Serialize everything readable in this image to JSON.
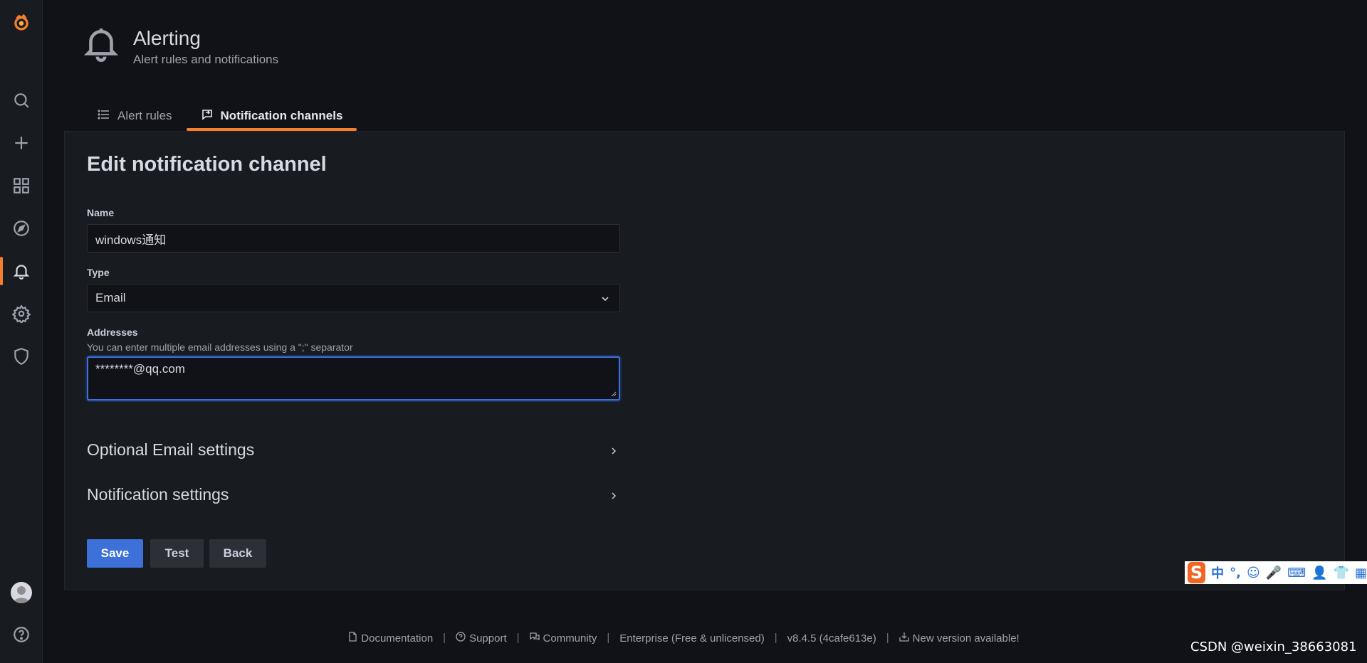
{
  "page": {
    "title": "Alerting",
    "subtitle": "Alert rules and notifications"
  },
  "tabs": [
    {
      "label": "Alert rules",
      "icon": "list-icon"
    },
    {
      "label": "Notification channels",
      "icon": "comment-alt-share-icon"
    }
  ],
  "form": {
    "heading": "Edit notification channel",
    "name_label": "Name",
    "name_value": "windows通知",
    "type_label": "Type",
    "type_value": "Email",
    "addresses_label": "Addresses",
    "addresses_desc": "You can enter multiple email addresses using a \";\" separator",
    "addresses_value": "********@qq.com",
    "optional_email_settings": "Optional Email settings",
    "notification_settings": "Notification settings",
    "save_label": "Save",
    "test_label": "Test",
    "back_label": "Back"
  },
  "footer": {
    "documentation": "Documentation",
    "support": "Support",
    "community": "Community",
    "edition": "Enterprise (Free & unlicensed)",
    "version": "v8.4.5 (4cafe613e)",
    "new_version": "New version available!"
  },
  "ime": {
    "logo": "S",
    "items": [
      "中",
      "°,",
      "☺",
      "🎤",
      "⌨",
      "👤",
      "👕",
      "▦"
    ]
  },
  "watermark": "CSDN @weixin_38663081",
  "colors": {
    "accent": "#f47f2e",
    "primary": "#3d71d9",
    "background": "#111217",
    "panel": "#181b1f"
  }
}
